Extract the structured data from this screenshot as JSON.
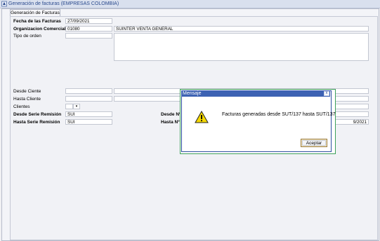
{
  "window": {
    "title": "Generación de facturas (EMPRESAS COLOMBIA)"
  },
  "tab": {
    "label": "Generación de Facturas"
  },
  "form": {
    "fecha_label": "Fecha de las Facturas",
    "fecha_value": "27/09/2021",
    "org_label": "Organizacion Comercial",
    "org_code": "01080",
    "org_name": "SUINTER VENTA GENERAL",
    "tipo_label": "Tipo de orden",
    "desde_cliente_label": "Desde Ciente",
    "hasta_cliente_label": "Hasta Cliente",
    "clientes_label": "Clientes",
    "desde_serie_label": "Desde Serie Remisión",
    "desde_serie_value": "SUI",
    "hasta_serie_label": "Hasta Serie Remisión",
    "hasta_serie_value": "SUI",
    "desde_no_label": "Desde Nº I",
    "hasta_no_label": "Hasta Nº I",
    "hasta_date_partial": "9/2021"
  },
  "dialog": {
    "title": "Mensaje",
    "close_glyph": "x",
    "message": "Facturas generadas desde SUT/137 hasta SUT/137",
    "ok_label": "Aceptar",
    "icon": "warning-icon"
  },
  "colors": {
    "dialog_title_bg": "#3d62b3",
    "accent": "#2a4a8e"
  }
}
